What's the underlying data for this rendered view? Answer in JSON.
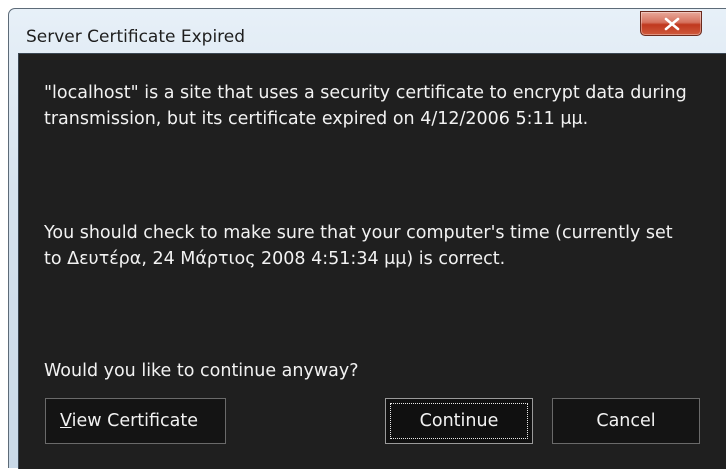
{
  "window": {
    "title": "Server Certificate Expired"
  },
  "message": {
    "paragraph1": "\"localhost\" is a site that uses a security certificate to encrypt data during transmission, but its certificate expired on 4/12/2006 5:11 μμ.",
    "paragraph2": "You should check to make sure that your computer's time (currently set to Δευτέρα, 24 Μάρτιος 2008 4:51:34 μμ) is correct.",
    "question": "Would you like to continue anyway?"
  },
  "buttons": {
    "view_certificate_accel": "V",
    "view_certificate_rest": "iew Certificate",
    "continue": "Continue",
    "cancel": "Cancel"
  },
  "colors": {
    "content_bg": "#1f1f1f",
    "text": "#f2f2f2",
    "close_button": "#c0381f"
  },
  "icons": {
    "close": "close-icon"
  }
}
